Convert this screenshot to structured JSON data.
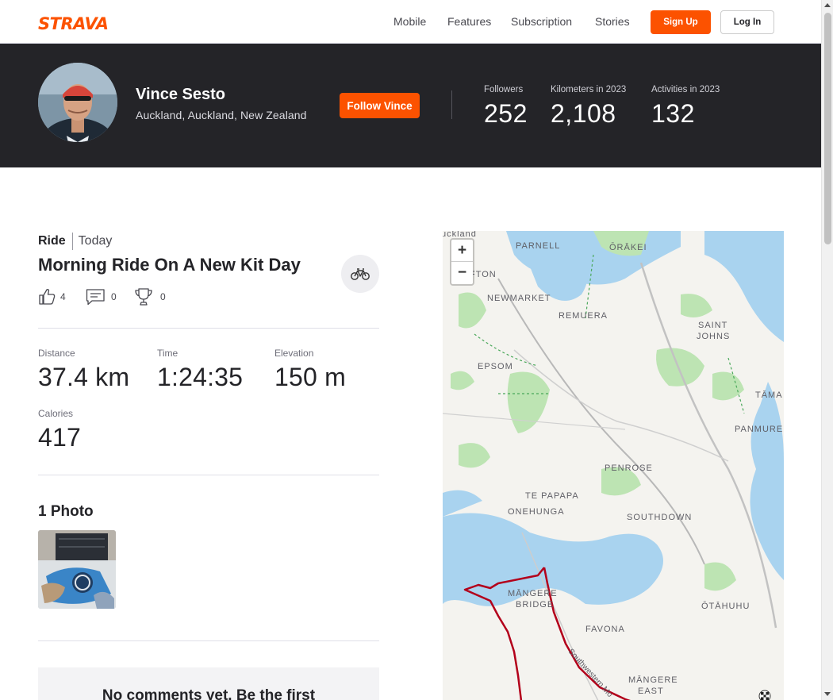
{
  "nav": {
    "logo": "STRAVA",
    "links": [
      "Mobile",
      "Features",
      "Subscription",
      "Stories"
    ],
    "signup_label": "Sign Up",
    "login_label": "Log In"
  },
  "athlete": {
    "name": "Vince Sesto",
    "location": "Auckland, Auckland, New Zealand",
    "follow_label": "Follow Vince",
    "stats": [
      {
        "label": "Followers",
        "value": "252"
      },
      {
        "label": "Kilometers in 2023",
        "value": "2,108"
      },
      {
        "label": "Activities in 2023",
        "value": "132"
      }
    ]
  },
  "activity": {
    "type": "Ride",
    "when": "Today",
    "title": "Morning Ride On A New Kit Day",
    "kudos": "4",
    "comments": "0",
    "achievements": "0",
    "metrics": [
      {
        "label": "Distance",
        "value": "37.4 km"
      },
      {
        "label": "Time",
        "value": "1:24:35"
      },
      {
        "label": "Elevation",
        "value": "150 m"
      },
      {
        "label": "Calories",
        "value": "417"
      }
    ],
    "photos_heading": "1 Photo",
    "comments_empty": "No comments yet. Be the first"
  },
  "map": {
    "zoom_in": "+",
    "zoom_out": "−",
    "labels": [
      "uckland",
      "PARNELL",
      "ŌRĀKEI",
      "FTON",
      "NEWMARKET",
      "REMUERA",
      "SAINT",
      "JOHNS",
      "EPSOM",
      "TĀMA",
      "PANMURE",
      "PENROSE",
      "TE PAPAPA",
      "ONEHUNGA",
      "SOUTHDOWN",
      "MĀNGERE",
      "BRIDGE",
      "FAVONA",
      "ŌTĀHUHU",
      "MĀNGERE",
      "EAST",
      "Southwestern Mo"
    ]
  },
  "colors": {
    "brand": "#fc5200",
    "header_bg": "#242428",
    "route": "#b3001b",
    "water": "#a9d3ef",
    "park": "#bde4b3"
  },
  "icons": {
    "kudos": "thumbs-up-icon",
    "comments": "comment-icon",
    "achievements": "trophy-icon",
    "sport": "bike-icon",
    "finish": "checkered-flag-icon"
  }
}
